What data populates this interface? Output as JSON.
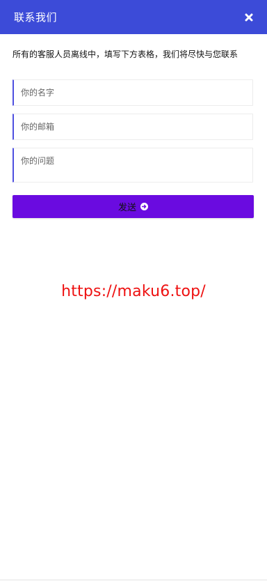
{
  "header": {
    "title": "联系我们",
    "bg_color": "#3c4bd8",
    "close_icon": "close-icon"
  },
  "notice": "所有的客服人员离线中，填写下方表格，我们将尽快与您联系",
  "form": {
    "name_placeholder": "你的名字",
    "email_placeholder": "你的邮箱",
    "question_placeholder": "你的问题",
    "accent_color": "#4e4fe0"
  },
  "send_button": {
    "label": "发送",
    "icon": "arrow-right-circle-icon",
    "bg_color": "#6a0be0"
  },
  "watermark": {
    "text": "https://maku6.top/",
    "color": "#ee1111"
  }
}
